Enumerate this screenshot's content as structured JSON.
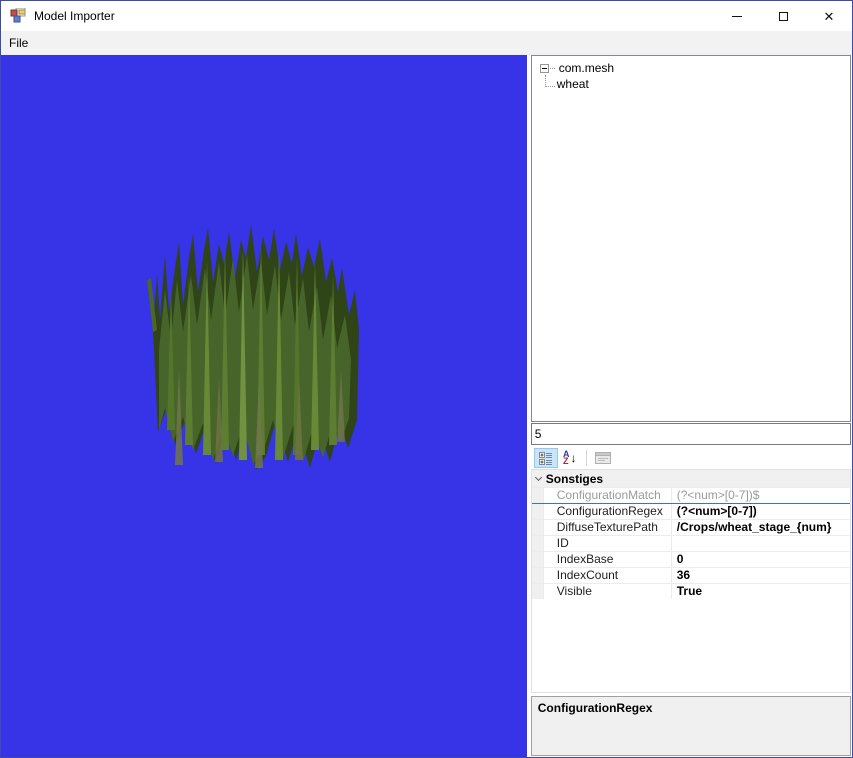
{
  "window": {
    "title": "Model Importer",
    "controls": {
      "minimize": "",
      "maximize": "",
      "close": "✕"
    }
  },
  "menu": {
    "items": [
      {
        "label": "File"
      }
    ]
  },
  "tree": {
    "root": {
      "label": "com.mesh"
    },
    "child": {
      "label": "wheat"
    }
  },
  "filter_box": {
    "value": "5"
  },
  "property_grid": {
    "toolbar": {
      "az": {
        "a": "A",
        "z": "Z",
        "arrow": "↓"
      }
    },
    "category": {
      "label": "Sonstiges"
    },
    "rows": [
      {
        "name": "ConfigurationMatch",
        "value": "(?<num>[0-7])$"
      },
      {
        "name": "ConfigurationRegex",
        "value": "(?<num>[0-7])"
      },
      {
        "name": "DiffuseTexturePath",
        "value": "/Crops/wheat_stage_{num}"
      },
      {
        "name": "ID",
        "value": ""
      },
      {
        "name": "IndexBase",
        "value": "0"
      },
      {
        "name": "IndexCount",
        "value": "36"
      },
      {
        "name": "Visible",
        "value": "True"
      }
    ]
  },
  "help_panel": {
    "title": "ConfigurationRegex"
  },
  "colors": {
    "viewport_bg": "#3733e6",
    "window_border": "#3c4aa8",
    "toolbar_selected_bg": "#cce4f7",
    "category_bg": "#f0f0f0",
    "grid_line": "#ececec",
    "readonly_text": "#9b9b9b",
    "selected_row_line": "#3f72bc",
    "help_bg": "#f0f0f0"
  }
}
